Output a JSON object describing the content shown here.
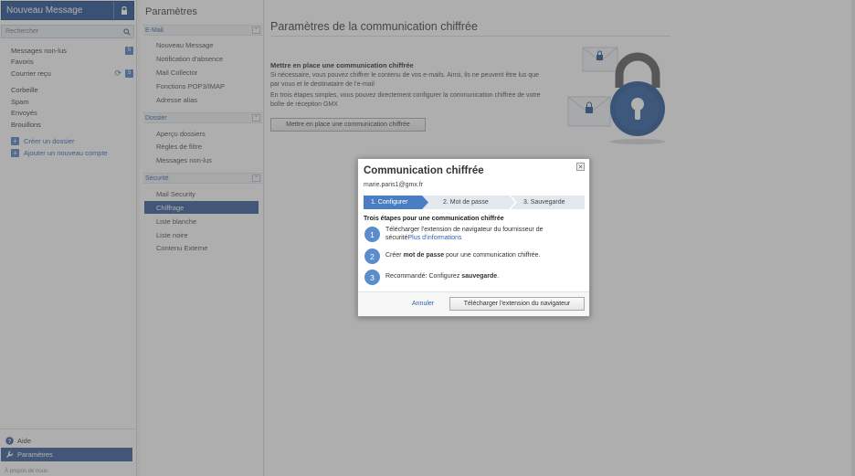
{
  "sidebar": {
    "new_message": "Nouveau Message",
    "search_placeholder": "Rechercher",
    "folders": [
      {
        "name": "Messages non-lus",
        "badge": "5"
      },
      {
        "name": "Favoris"
      },
      {
        "name": "Courrier reçu",
        "badge": "5",
        "refresh": true
      },
      {
        "name": "Corbeille"
      },
      {
        "name": "Spam"
      },
      {
        "name": "Envoyés"
      },
      {
        "name": "Brouillons"
      }
    ],
    "actions": [
      "Créer un dossier",
      "Ajouter un nouveau compte"
    ],
    "bottom": {
      "help": "Aide",
      "settings": "Paramètres",
      "about": "À propos de nous"
    }
  },
  "settings_nav": {
    "title": "Paramètres",
    "sections": [
      {
        "label": "E-Mail",
        "items": [
          "Nouveau Message",
          "Notification d'absence",
          "Mail Collector",
          "Fonctions POP3/IMAP",
          "Adresse alias"
        ]
      },
      {
        "label": "Dossier",
        "items": [
          "Aperçu dossiers",
          "Règles de filtre",
          "Messages non-lus"
        ]
      },
      {
        "label": "Sécurité",
        "items": [
          "Mail Security",
          "Chiffrage",
          "Liste blanche",
          "Liste noire",
          "Contenu Externe"
        ]
      }
    ],
    "active_item": "Chiffrage"
  },
  "main": {
    "title": "Paramètres de la communication chiffrée",
    "heading": "Mettre en place une communication chiffrée",
    "paragraph1": "Si nécessaire, vous pouvez chiffrer le contenu de vos e-mails. Ainsi, ils ne peuvent être lus que par vous et le destinataire de l'e-mail",
    "paragraph2": "En trois étapes simples, vous pouvez directement configurer la communication chiffrée de votre boîte de réception GMX",
    "button": "Mettre en place une communication chiffrée"
  },
  "modal": {
    "title": "Communication chiffrée",
    "close": "✕",
    "email": "marie.paris1@gmx.fr",
    "steps": [
      "1. Configurer",
      "2. Mot de passe",
      "3. Sauvegarde"
    ],
    "active_step": 1,
    "subtitle": "Trois étapes pour une communication chiffrée",
    "items": [
      {
        "num": "1",
        "text": "Télécharger l'extension de navigateur du fournisseur de sécurité",
        "link": "Plus d'informations"
      },
      {
        "num": "2",
        "pre": "Créer ",
        "bold": "mot de passe",
        "post": " pour une communication chiffrée."
      },
      {
        "num": "3",
        "pre": "Recommandé: Configurez ",
        "bold": "sauvegarde",
        "post": "."
      }
    ],
    "cancel": "Annuler",
    "download": "Télécharger l'extension du navigateur"
  },
  "colors": {
    "brand": "#1b4a8c",
    "active": "#2c5592",
    "accent": "#4a7ec2",
    "link": "#2a64b1"
  }
}
